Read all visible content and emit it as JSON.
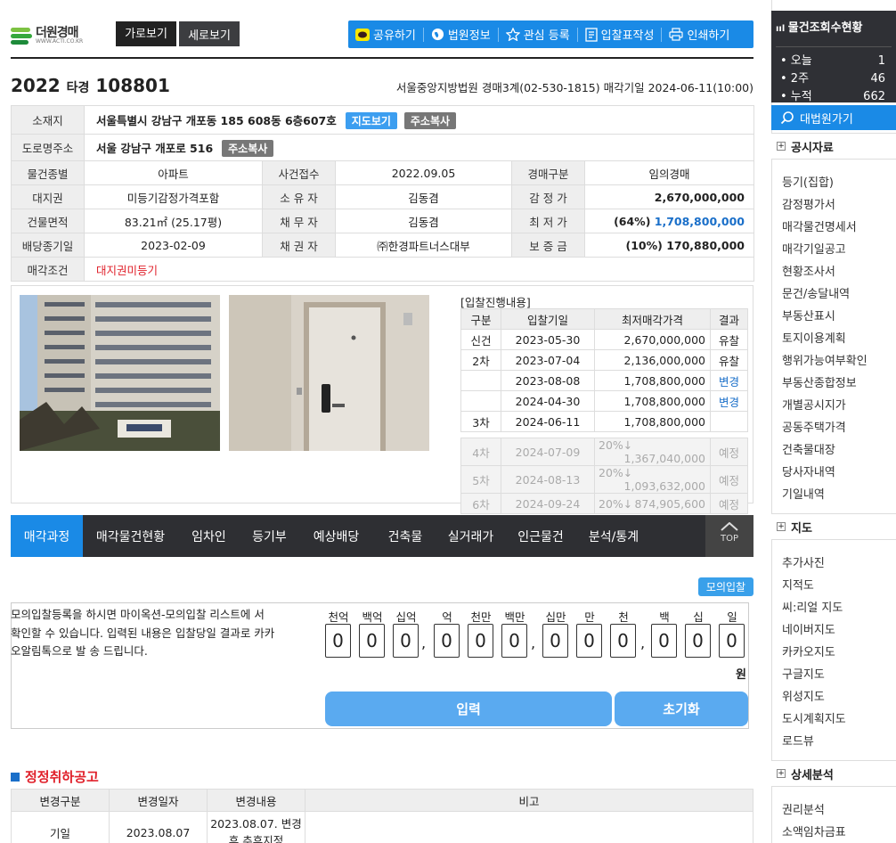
{
  "logo": {
    "name": "더원경매",
    "url": "WWW.ACTI.CO.KR"
  },
  "view_buttons": [
    "가로보기",
    "세로보기"
  ],
  "toolbar": [
    "공유하기",
    "법원정보",
    "관심 등록",
    "입찰표작성",
    "인쇄하기"
  ],
  "case": {
    "year": "2022",
    "type": "타경",
    "number": "108801",
    "court": "서울중앙지방법원 경매3계(02-530-1815) 매각기일 2024-06-11(10:00)"
  },
  "info": {
    "address_label": "소재지",
    "address": "서울특별시 강남구 개포동 185 608동 6층607호",
    "map_btn": "지도보기",
    "copy_btn": "주소복사",
    "road_label": "도로명주소",
    "road": "서울 강남구 개포로 516",
    "copy_btn2": "주소복사",
    "rows": [
      [
        "물건종별",
        "아파트",
        "사건접수",
        "2022.09.05",
        "경매구분",
        "임의경매"
      ],
      [
        "대지권",
        "미등기감정가격포함",
        "소 유 자",
        "김동겸",
        "감 정 가",
        "2,670,000,000"
      ],
      [
        "건물면적",
        "83.21㎡ (25.17평)",
        "채 무 자",
        "김동겸",
        "최 저 가",
        "(64%) ",
        "1,708,800,000"
      ],
      [
        "배당종기일",
        "2023-02-09",
        "채 권 자",
        "㈜한경파트너스대부",
        "보 증 금",
        "(10%) 170,880,000"
      ]
    ],
    "cond_label": "매각조건",
    "cond": "대지권미등기"
  },
  "bid": {
    "title": "[입찰진행내용]",
    "headers": [
      "구분",
      "입찰기일",
      "최저매각가격",
      "결과"
    ],
    "rows": [
      [
        "신건",
        "2023-05-30",
        "2,670,000,000",
        "유찰"
      ],
      [
        "2차",
        "2023-07-04",
        "2,136,000,000",
        "유찰"
      ],
      [
        "",
        "2023-08-08",
        "1,708,800,000",
        "변경"
      ],
      [
        "",
        "2024-04-30",
        "1,708,800,000",
        "변경"
      ],
      [
        "3차",
        "2024-06-11",
        "1,708,800,000",
        ""
      ]
    ],
    "future": [
      [
        "4차",
        "2024-07-09",
        "20%↓",
        "1,367,040,000",
        "예정"
      ],
      [
        "5차",
        "2024-08-13",
        "20%↓",
        "1,093,632,000",
        "예정"
      ],
      [
        "6차",
        "2024-09-24",
        "20%↓",
        "874,905,600",
        "예정"
      ]
    ]
  },
  "tabs": [
    "매각과정",
    "매각물건현황",
    "임차인",
    "등기부",
    "예상배당",
    "건축물",
    "실거래가",
    "인근물건",
    "분석/통계"
  ],
  "top_label": "TOP",
  "mock": {
    "button": "모의입찰",
    "text": "모의입찰등록을 하시면 마이옥션-모의입찰 리스트에 서 확인할 수 있습니다. 입력된 내용은 입찰당일 결과로 카카오알림톡으로 발 송 드립니다.",
    "units": [
      "천억",
      "백억",
      "십억",
      "억",
      "천만",
      "백만",
      "십만",
      "만",
      "천",
      "백",
      "십",
      "일"
    ],
    "digits": [
      "0",
      "0",
      "0",
      "0",
      "0",
      "0",
      "0",
      "0",
      "0",
      "0",
      "0",
      "0"
    ],
    "won": "원",
    "submit": "입력",
    "reset": "초기화"
  },
  "changes": {
    "title": "정정취하공고",
    "headers": [
      "변경구분",
      "변경일자",
      "변경내용",
      "비고"
    ],
    "row": [
      "기일",
      "2023.08.07",
      "2023.08.07. 변경 후 추후지정",
      ""
    ]
  },
  "sidebar": {
    "title": "물건조회수현황",
    "stats": [
      {
        "label": "• 오늘",
        "value": "1"
      },
      {
        "label": "• 2주",
        "value": "46"
      },
      {
        "label": "• 누적",
        "value": "662"
      }
    ],
    "court_btn": "대법원가기",
    "sections": [
      {
        "title": "공시자료",
        "items": [
          "등기(집합)",
          "감정평가서",
          "매각물건명세서",
          "매각기일공고",
          "현황조사서",
          "문건/송달내역",
          "부동산표시",
          "토지이용계획",
          "행위가능여부확인",
          "부동산종합정보",
          "개별공시지가",
          "공동주택가격",
          "건축물대장",
          "당사자내역",
          "기일내역"
        ]
      },
      {
        "title": "지도",
        "items": [
          "추가사진",
          "지적도",
          "씨:리얼 지도",
          "네이버지도",
          "카카오지도",
          "구글지도",
          "위성지도",
          "도시계획지도",
          "로드뷰"
        ]
      },
      {
        "title": "상세분석",
        "items": [
          "권리분석",
          "소액임차금표"
        ]
      }
    ]
  },
  "colors": {
    "accent": "#1a8ae6",
    "dark": "#2e2f33",
    "red": "#e0202a"
  }
}
